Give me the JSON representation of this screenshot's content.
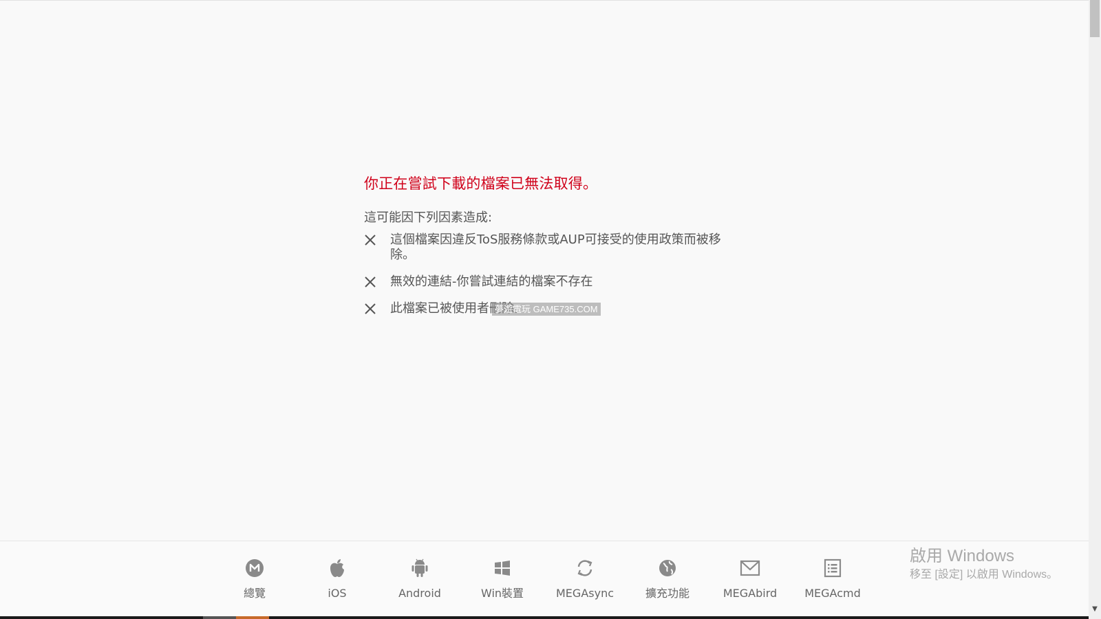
{
  "error": {
    "title": "你正在嘗試下載的檔案已無法取得。",
    "intro": "這可能因下列因素造成:",
    "reasons": [
      "這個檔案因違反ToS服務條款或AUP可接受的使用政策而被移除。",
      "無效的連結-你嘗試連結的檔案不存在",
      "此檔案已被使用者刪除。"
    ],
    "reason_icon": "x-icon",
    "title_color": "#d0021b"
  },
  "watermark": "夢遊電玩 GAME735.COM",
  "footer": {
    "nav": [
      {
        "label": "總覽",
        "icon": "mega-logo-icon"
      },
      {
        "label": "iOS",
        "icon": "apple-icon"
      },
      {
        "label": "Android",
        "icon": "android-icon"
      },
      {
        "label": "Win裝置",
        "icon": "windows-icon"
      },
      {
        "label": "MEGAsync",
        "icon": "sync-icon"
      },
      {
        "label": "擴充功能",
        "icon": "globe-icon"
      },
      {
        "label": "MEGAbird",
        "icon": "mail-icon"
      },
      {
        "label": "MEGAcmd",
        "icon": "terminal-list-icon"
      }
    ]
  },
  "activate_windows": {
    "title": "啟用 Windows",
    "subtitle": "移至 [設定] 以啟用 Windows。"
  },
  "scrollbar": {
    "down_arrow": "▼"
  }
}
